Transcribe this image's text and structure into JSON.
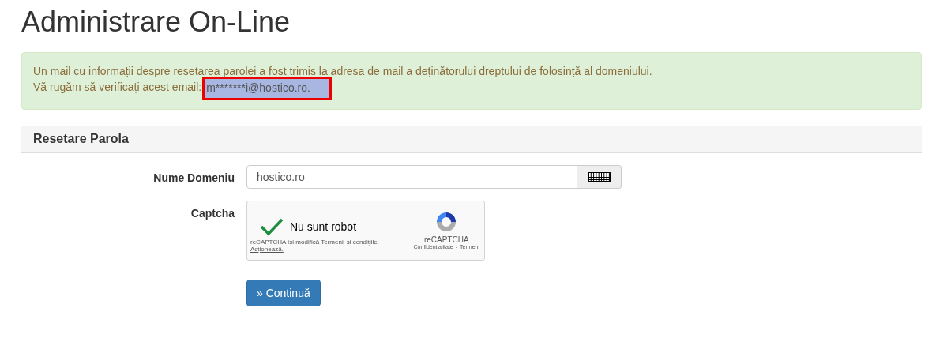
{
  "page_title": "Administrare On-Line",
  "alert": {
    "line_1": "Un mail cu informații despre resetarea parolei a fost trimis la adresa de mail a deținătorului dreptului de folosință al domeniului.",
    "line_2": "Vă rugăm să verificați acest email:",
    "email": "m*******i@hostico.ro.",
    "email_highlighted": true
  },
  "panel": {
    "title": "Resetare Parola",
    "domain_field": {
      "label": "Nume Domeniu",
      "value": "hostico.ro"
    },
    "captcha": {
      "label": "Captcha",
      "checked": true,
      "text": "Nu sunt robot",
      "notice": "reCAPTCHA își modifică Termenii și condițiile.",
      "notice_link": "Acționează.",
      "brand": "reCAPTCHA",
      "privacy": "Confidențialitate",
      "separator": "-",
      "terms": "Termeni"
    },
    "submit": "» Continuă"
  }
}
